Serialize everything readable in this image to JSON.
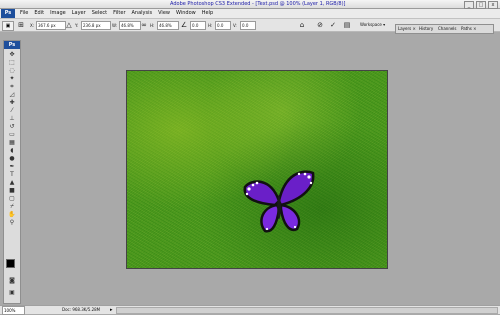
{
  "window": {
    "title": "Adobe Photoshop CS3 Extended - [Text.psd @ 100% (Layer 1, RGB/8)]",
    "minimize": "_",
    "maximize": "□",
    "close": "x"
  },
  "menubar": {
    "logo": "Ps",
    "items": [
      "File",
      "Edit",
      "Image",
      "Layer",
      "Select",
      "Filter",
      "Analysis",
      "View",
      "Window",
      "Help"
    ]
  },
  "options": {
    "x_label": "X:",
    "x_value": "367.6 px",
    "y_label": "Y:",
    "y_value": "236.8 px",
    "w_label": "W:",
    "w_value": "46.8%",
    "h_label": "H:",
    "h_value": "46.8%",
    "angle_value": "0.0",
    "hskew_label": "H:",
    "hskew_value": "0.0",
    "vskew_label": "V:",
    "vskew_value": "0.0",
    "workspace_label": "Workspace ▾"
  },
  "panels": {
    "tabs": [
      "Layers ×",
      "History",
      "Channels",
      "Paths ×"
    ]
  },
  "toolbox": {
    "logo": "Ps"
  },
  "status": {
    "zoom": "100%",
    "doc": "Doc: 968.3K/5.28M",
    "arrow": "▸"
  }
}
